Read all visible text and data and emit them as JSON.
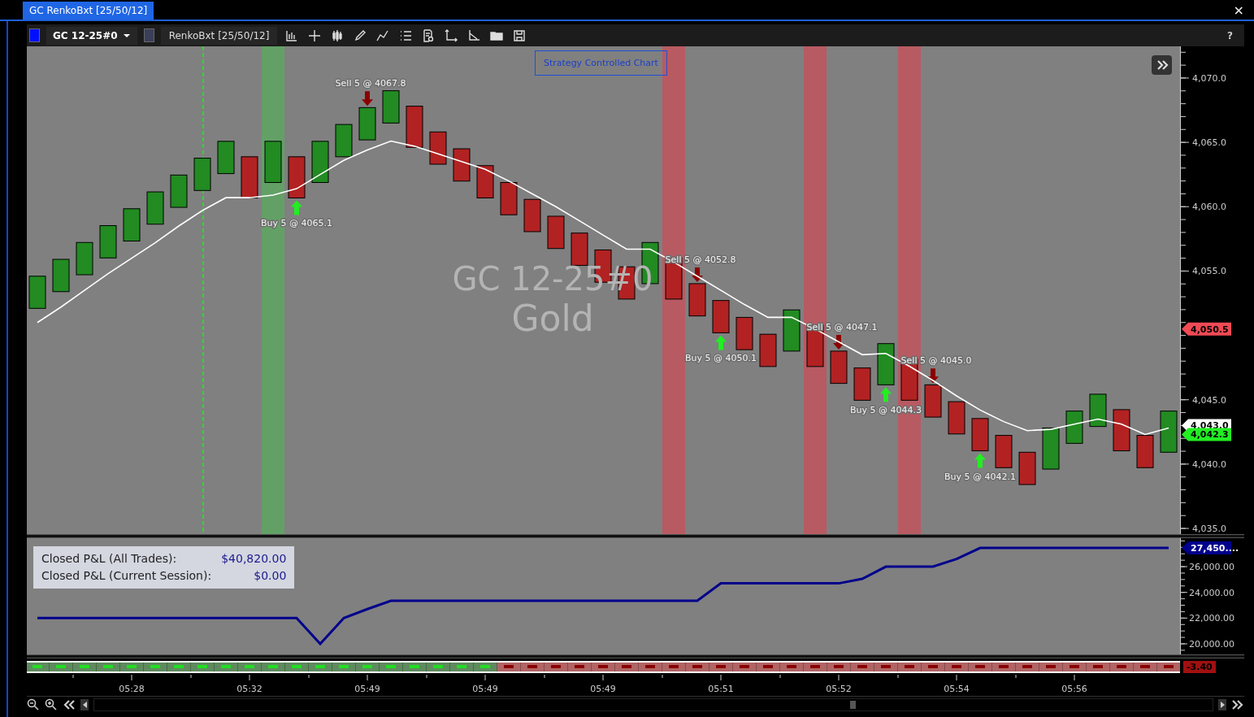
{
  "window": {
    "title": "GC RenkoBxt [25/50/12]",
    "close": "×"
  },
  "toolbar": {
    "instrument": "GC 12-25#0",
    "bar_type": "RenkoBxt [25/50/12]",
    "help": "?"
  },
  "price_panel": {
    "watermark": [
      "GC 12-25#0",
      "Gold"
    ],
    "badge": "Strategy Controlled Chart",
    "bricks": [
      {
        "bullish": true,
        "kind": "plain"
      },
      {
        "bullish": true,
        "kind": "plain"
      },
      {
        "bullish": true,
        "kind": "plain"
      },
      {
        "bullish": true,
        "kind": "plain"
      },
      {
        "bullish": true,
        "kind": "plain"
      },
      {
        "bullish": true,
        "kind": "plain"
      },
      {
        "bullish": true,
        "kind": "plain"
      },
      {
        "bullish": true,
        "kind": "plain",
        "marker": true
      },
      {
        "bullish": true,
        "kind": "plain"
      },
      {
        "bullish": false,
        "kind": "plain"
      },
      {
        "bullish": true,
        "kind": "plain",
        "color": "#63a066"
      },
      {
        "bullish": false,
        "kind": "buy",
        "trade": "Buy 5 @ 4065.1"
      },
      {
        "bullish": true,
        "kind": "plain"
      },
      {
        "bullish": true,
        "kind": "plain"
      },
      {
        "bullish": true,
        "kind": "sell",
        "trade": "Sell 5 @ 4067.8"
      },
      {
        "bullish": true,
        "kind": "plain"
      },
      {
        "bullish": false,
        "kind": "plain"
      },
      {
        "bullish": false,
        "kind": "plain"
      },
      {
        "bullish": false,
        "kind": "plain"
      },
      {
        "bullish": false,
        "kind": "plain"
      },
      {
        "bullish": false,
        "kind": "plain"
      },
      {
        "bullish": false,
        "kind": "plain"
      },
      {
        "bullish": false,
        "kind": "plain"
      },
      {
        "bullish": false,
        "kind": "plain"
      },
      {
        "bullish": false,
        "kind": "plain"
      },
      {
        "bullish": false,
        "kind": "plain"
      },
      {
        "bullish": true,
        "kind": "plain"
      },
      {
        "bullish": false,
        "kind": "plain",
        "color": "#b85a62"
      },
      {
        "bullish": false,
        "kind": "sell",
        "trade": "Sell 5 @ 4052.8"
      },
      {
        "bullish": false,
        "kind": "buy",
        "trade": "Buy 5 @ 4050.1"
      },
      {
        "bullish": false,
        "kind": "plain"
      },
      {
        "bullish": false,
        "kind": "plain"
      },
      {
        "bullish": true,
        "kind": "plain"
      },
      {
        "bullish": false,
        "kind": "plain",
        "color": "#b85a62"
      },
      {
        "bullish": false,
        "kind": "sell",
        "trade": "Sell 5 @ 4047.1"
      },
      {
        "bullish": false,
        "kind": "plain"
      },
      {
        "bullish": true,
        "kind": "buy",
        "trade": "Buy 5 @ 4044.3"
      },
      {
        "bullish": false,
        "kind": "plain",
        "color": "#b85a62"
      },
      {
        "bullish": false,
        "kind": "sell",
        "trade": "Sell 5 @ 4045.0"
      },
      {
        "bullish": false,
        "kind": "plain"
      },
      {
        "bullish": false,
        "kind": "buy",
        "trade": "Buy 5 @ 4042.1"
      },
      {
        "bullish": false,
        "kind": "plain"
      },
      {
        "bullish": false,
        "kind": "plain"
      },
      {
        "bullish": true,
        "kind": "plain"
      },
      {
        "bullish": true,
        "kind": "plain"
      },
      {
        "bullish": true,
        "kind": "plain"
      },
      {
        "bullish": false,
        "kind": "plain"
      },
      {
        "bullish": false,
        "kind": "plain"
      },
      {
        "bullish": true,
        "kind": "plain"
      }
    ],
    "chart_data": {
      "type": "line",
      "ylim": [
        4034.56,
        4072.46
      ],
      "yticks": [
        {
          "value": 4070,
          "label": "4,070.0"
        },
        {
          "value": 4065,
          "label": "4,065.0"
        },
        {
          "value": 4060,
          "label": "4,060.0"
        },
        {
          "value": 4055,
          "label": "4,055.0"
        },
        {
          "value": 4045,
          "label": "4,045.0"
        },
        {
          "value": 4040,
          "label": "4,040.0"
        },
        {
          "value": 4035,
          "label": "4,035.0"
        },
        {
          "value": 4050.5,
          "label": "4,050.5"
        },
        {
          "value": 4043.0,
          "label": "4,043.0"
        },
        {
          "value": 4042.3,
          "label": "4,042.3"
        }
      ],
      "series": [
        {
          "color": "#ffffff",
          "values": [
            4051.0,
            4052.2,
            4053.5,
            4054.8,
            4056.0,
            4057.2,
            4058.5,
            4059.7,
            4060.7,
            4060.7,
            4060.9,
            4061.4,
            4062.5,
            4063.6,
            4064.4,
            4065.1,
            4064.7,
            4064.1,
            4063.5,
            4062.9,
            4062.0,
            4061.0,
            4060.0,
            4058.9,
            4057.8,
            4056.7,
            4056.7,
            4055.7,
            4054.6,
            4053.5,
            4052.4,
            4051.4,
            4051.4,
            4050.5,
            4049.5,
            4048.5,
            4048.6,
            4047.6,
            4046.5,
            4045.3,
            4044.2,
            4043.3,
            4042.6,
            4042.7,
            4043.1,
            4043.5,
            4043.1,
            4042.3,
            4042.8
          ]
        }
      ]
    },
    "price_tags": [
      {
        "color": "#f04a55"
      },
      {
        "color": "#ffffff"
      },
      {
        "color": "#22ee22"
      }
    ]
  },
  "pnl_panel": {
    "stats": [
      {
        "label": "Closed P&L (All Trades):",
        "value": "$40,820.00"
      },
      {
        "label": "Closed P&L (Current Session):",
        "value": "$0.00"
      }
    ],
    "chart_data": {
      "type": "line",
      "ylim": [
        19177,
        28215
      ],
      "yticks": [
        {
          "value": 26000,
          "label": "26,000.00"
        },
        {
          "value": 24000,
          "label": "24,000.00"
        },
        {
          "value": 22000,
          "label": "22,000.00"
        },
        {
          "value": 20000,
          "label": "20,000.00"
        },
        {
          "value": 27450,
          "label": "27,450...."
        }
      ],
      "series": [
        {
          "color": "#00008b",
          "values": [
            22000,
            22000,
            22000,
            22000,
            22000,
            22000,
            22000,
            22000,
            22000,
            22000,
            22000,
            22000,
            20000,
            22000,
            22700,
            23350,
            23350,
            23350,
            23350,
            23350,
            23350,
            23350,
            23350,
            23350,
            23350,
            23350,
            23350,
            23350,
            23350,
            24700,
            24700,
            24700,
            24700,
            24700,
            24700,
            25050,
            26000,
            26000,
            26000,
            26600,
            27450,
            27450,
            27450,
            27450,
            27450,
            27450,
            27450,
            27450,
            27450
          ]
        }
      ]
    },
    "price_tags": [
      {
        "color": "#00008b"
      }
    ]
  },
  "signal_strip": {
    "tag": "-3.40",
    "segments": [
      {
        "bullish": true
      },
      {
        "bullish": true
      },
      {
        "bullish": true
      },
      {
        "bullish": true
      },
      {
        "bullish": true
      },
      {
        "bullish": true
      },
      {
        "bullish": true
      },
      {
        "bullish": true
      },
      {
        "bullish": true
      },
      {
        "bullish": true
      },
      {
        "bullish": true
      },
      {
        "bullish": true
      },
      {
        "bullish": true
      },
      {
        "bullish": true
      },
      {
        "bullish": true
      },
      {
        "bullish": true
      },
      {
        "bullish": true
      },
      {
        "bullish": true
      },
      {
        "bullish": true
      },
      {
        "bullish": true
      },
      {
        "bullish": false
      },
      {
        "bullish": false
      },
      {
        "bullish": false
      },
      {
        "bullish": false
      },
      {
        "bullish": false
      },
      {
        "bullish": false
      },
      {
        "bullish": false
      },
      {
        "bullish": false
      },
      {
        "bullish": false
      },
      {
        "bullish": false
      },
      {
        "bullish": false
      },
      {
        "bullish": false
      },
      {
        "bullish": false
      },
      {
        "bullish": false
      },
      {
        "bullish": false
      },
      {
        "bullish": false
      },
      {
        "bullish": false
      },
      {
        "bullish": false
      },
      {
        "bullish": false
      },
      {
        "bullish": false
      },
      {
        "bullish": false
      },
      {
        "bullish": false
      },
      {
        "bullish": false
      },
      {
        "bullish": false
      },
      {
        "bullish": false
      },
      {
        "bullish": false
      },
      {
        "bullish": false
      },
      {
        "bullish": false
      },
      {
        "bullish": false
      }
    ]
  },
  "time_axis": {
    "labels": [
      "05:28",
      "05:32",
      "05:49",
      "05:49",
      "05:49",
      "05:51",
      "05:52",
      "05:54",
      "05:56"
    ]
  }
}
